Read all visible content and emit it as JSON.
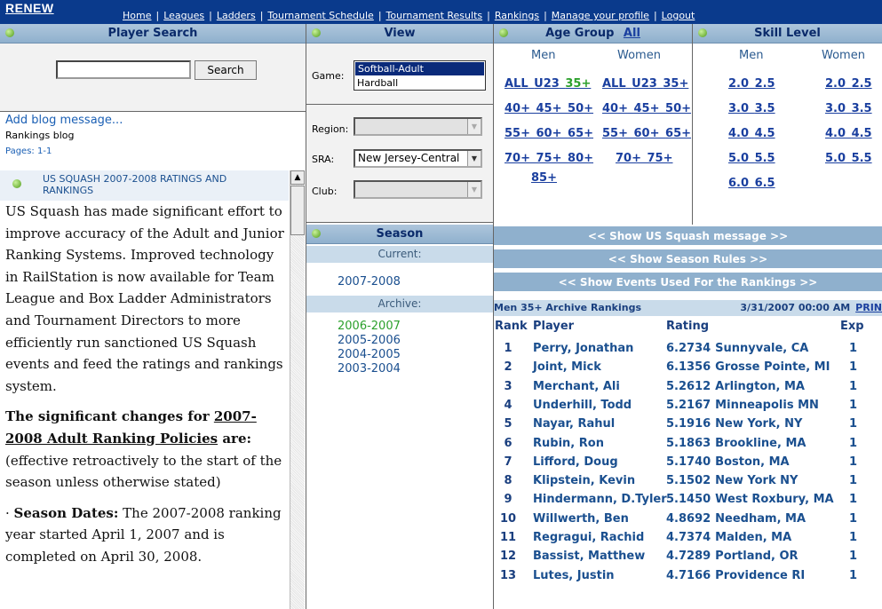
{
  "nav": {
    "logo": "RENEW",
    "links": [
      "Home",
      "Leagues",
      "Ladders",
      "Tournament Schedule",
      "Tournament Results",
      "Rankings",
      "Manage your profile",
      "Logout"
    ]
  },
  "player_search": {
    "title": "Player Search",
    "input_value": "",
    "button": "Search",
    "blog_link": "Add blog message...",
    "blog_title": "Rankings blog",
    "pages": "Pages: 1-1",
    "post_heading": "US SQUASH 2007-2008 RATINGS AND RANKINGS",
    "para1": "US Squash has made significant effort to improve accuracy of the Adult and Junior Ranking Systems. Improved technology in RailStation is now available for Team League and Box Ladder Administrators and Tournament Directors to more efficiently run sanctioned US Squash events and feed the ratings and rankings system.",
    "para2_bold1": "The significant changes for ",
    "para2_link": "2007-2008 Adult Ranking Policies",
    "para2_bold2": " are:",
    "para2_rest": " (effective retroactively to the start of the season unless otherwise stated)",
    "para3_prefix": "· ",
    "para3_bold": "Season Dates:",
    "para3_rest": " The 2007-2008 ranking year started April 1, 2007 and is completed on April 30, 2008."
  },
  "view": {
    "title": "View",
    "game_label": "Game:",
    "game_options": [
      "Softball-Adult",
      "Hardball"
    ],
    "game_selected": "Softball-Adult",
    "region_label": "Region:",
    "region_value": "",
    "sra_label": "SRA:",
    "sra_value": "New Jersey-Central",
    "club_label": "Club:",
    "club_value": ""
  },
  "season": {
    "title": "Season",
    "current_label": "Current:",
    "current": "2007-2008",
    "archive_label": "Archive:",
    "archive": [
      "2006-2007",
      "2005-2006",
      "2004-2005",
      "2003-2004"
    ],
    "archive_selected": "2006-2007"
  },
  "age_group": {
    "title": "Age Group",
    "all_link": "All",
    "men": "Men",
    "women": "Women",
    "men_rows": [
      [
        "ALL",
        "U23",
        "35+"
      ],
      [
        "40+",
        "45+",
        "50+"
      ],
      [
        "55+",
        "60+",
        "65+"
      ],
      [
        "70+",
        "75+",
        "80+"
      ],
      [
        "85+"
      ]
    ],
    "women_rows": [
      [
        "ALL",
        "U23",
        "35+"
      ],
      [
        "40+",
        "45+",
        "50+"
      ],
      [
        "55+",
        "60+",
        "65+"
      ],
      [
        "70+",
        "75+"
      ]
    ],
    "selected": "35+"
  },
  "skill_level": {
    "title": "Skill Level",
    "men": "Men",
    "women": "Women",
    "men_rows": [
      [
        "2.0",
        "2.5"
      ],
      [
        "3.0",
        "3.5"
      ],
      [
        "4.0",
        "4.5"
      ],
      [
        "5.0",
        "5.5"
      ],
      [
        "6.0",
        "6.5"
      ]
    ],
    "women_rows": [
      [
        "2.0",
        "2.5"
      ],
      [
        "3.0",
        "3.5"
      ],
      [
        "4.0",
        "4.5"
      ],
      [
        "5.0",
        "5.5"
      ]
    ]
  },
  "show_bars": [
    "<< Show US Squash message >>",
    "<< Show Season Rules >>",
    "<< Show Events Used For the Rankings >>"
  ],
  "rankings": {
    "heading": "Men 35+ Archive Rankings",
    "timestamp": "3/31/2007 00:00 AM",
    "print_link": "PRIN",
    "columns": [
      "Rank",
      "Player",
      "Rating",
      "Exp"
    ],
    "rows": [
      {
        "rank": "1",
        "player": "Perry, Jonathan",
        "rating": "6.2734",
        "location": "Sunnyvale, CA",
        "exp": "1"
      },
      {
        "rank": "2",
        "player": "Joint, Mick",
        "rating": "6.1356",
        "location": "Grosse Pointe, MI",
        "exp": "1"
      },
      {
        "rank": "3",
        "player": "Merchant, Ali",
        "rating": "5.2612",
        "location": "Arlington, MA",
        "exp": "1"
      },
      {
        "rank": "4",
        "player": "Underhill, Todd",
        "rating": "5.2167",
        "location": "Minneapolis MN",
        "exp": "1"
      },
      {
        "rank": "5",
        "player": "Nayar, Rahul",
        "rating": "5.1916",
        "location": "New York, NY",
        "exp": "1"
      },
      {
        "rank": "6",
        "player": "Rubin, Ron",
        "rating": "5.1863",
        "location": "Brookline, MA",
        "exp": "1"
      },
      {
        "rank": "7",
        "player": "Lifford, Doug",
        "rating": "5.1740",
        "location": "Boston, MA",
        "exp": "1"
      },
      {
        "rank": "8",
        "player": "Klipstein, Kevin",
        "rating": "5.1502",
        "location": "New York NY",
        "exp": "1"
      },
      {
        "rank": "9",
        "player": "Hindermann, D.Tyler",
        "rating": "5.1450",
        "location": "West Roxbury, MA",
        "exp": "1"
      },
      {
        "rank": "10",
        "player": "Willwerth, Ben",
        "rating": "4.8692",
        "location": "Needham, MA",
        "exp": "1"
      },
      {
        "rank": "11",
        "player": "Regragui, Rachid",
        "rating": "4.7374",
        "location": "Malden, MA",
        "exp": "1"
      },
      {
        "rank": "12",
        "player": "Bassist, Matthew",
        "rating": "4.7289",
        "location": "Portland, OR",
        "exp": "1"
      },
      {
        "rank": "13",
        "player": "Lutes, Justin",
        "rating": "4.7166",
        "location": "Providence RI",
        "exp": "1"
      }
    ]
  },
  "colors": {
    "nav_bg": "#0a3a8c",
    "header_bg": "#8fb0cd",
    "link": "#1a3f9f",
    "selected_green": "#2ca02c"
  }
}
